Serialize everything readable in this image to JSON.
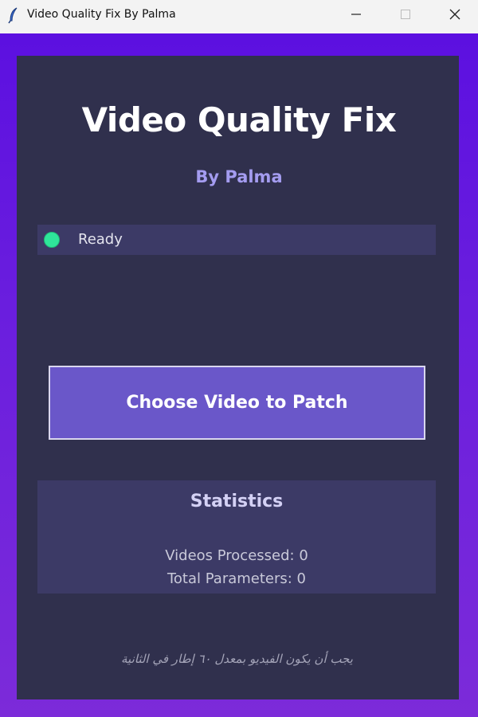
{
  "window": {
    "title": "Video Quality Fix By Palma",
    "icon": "feather-icon",
    "controls": {
      "minimize": "—",
      "maximize": "☐",
      "close": "✕"
    }
  },
  "app": {
    "title": "Video Quality Fix",
    "subtitle": "By Palma"
  },
  "status": {
    "text": "Ready",
    "indicator_color": "#2fe59a"
  },
  "actions": {
    "choose_video_label": "Choose Video to Patch"
  },
  "statistics": {
    "title": "Statistics",
    "videos_processed": "Videos Processed: 0",
    "total_parameters": "Total Parameters: 0"
  },
  "footer": {
    "note": "يجب أن يكون الفيديو بمعدل ٦٠ إطار في الثانية"
  },
  "colors": {
    "gradient_top": "#5c10e0",
    "gradient_bottom": "#7c2bd9",
    "panel": "#30304d",
    "accent_button": "#6a57c9",
    "subtitle": "#a49cf0"
  }
}
